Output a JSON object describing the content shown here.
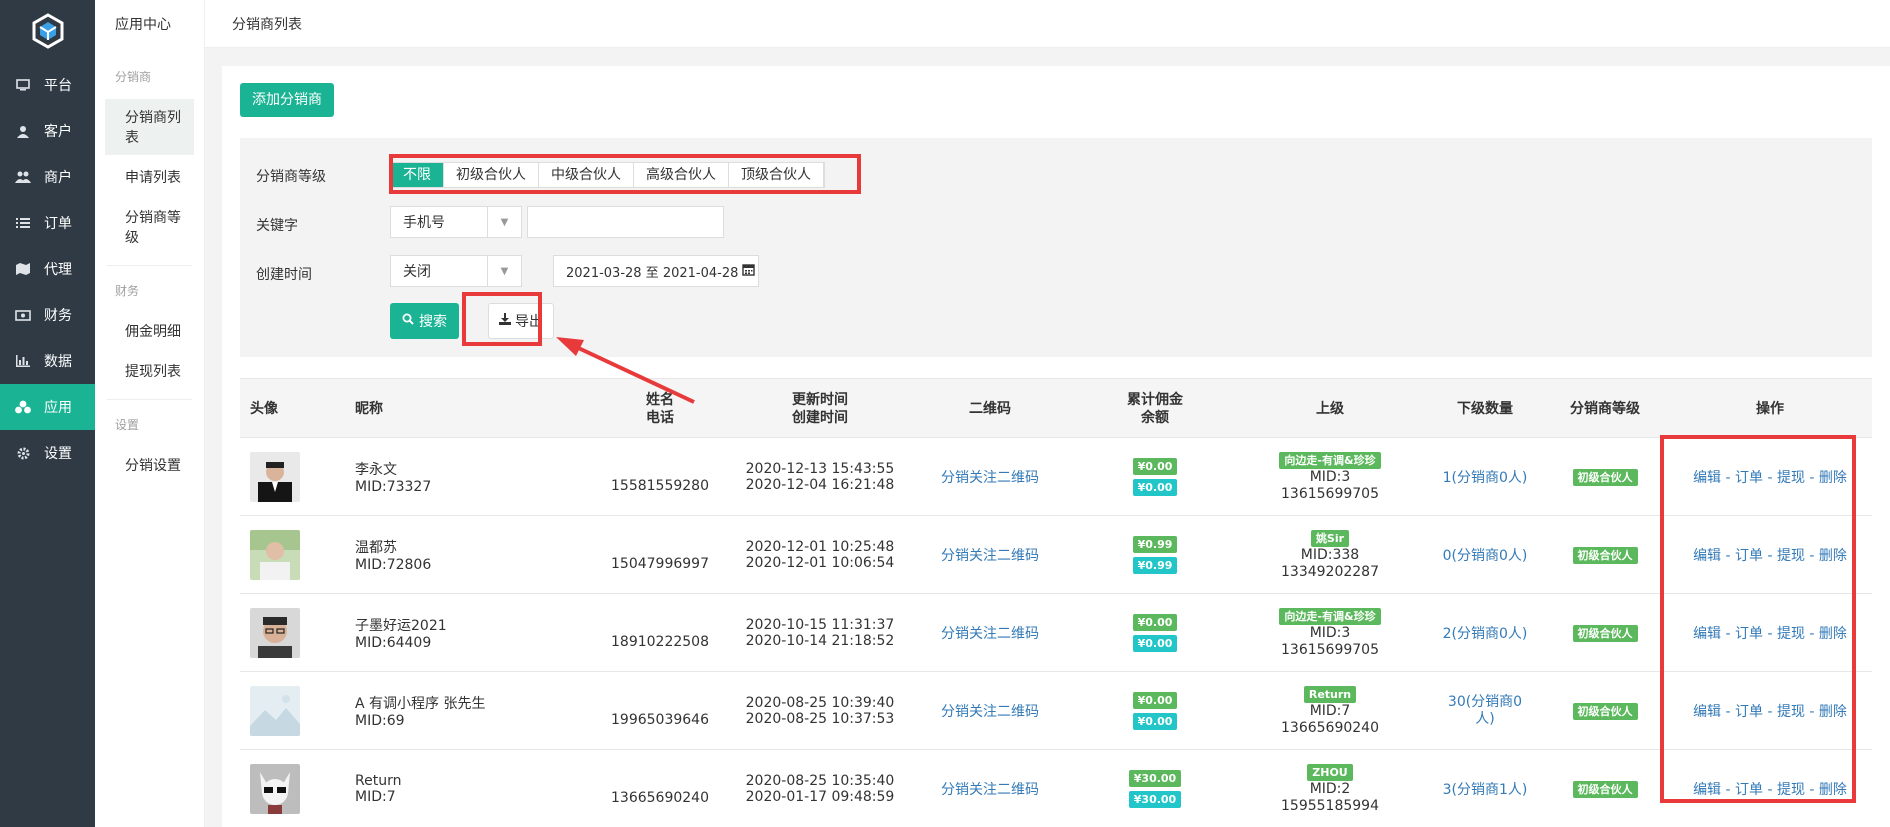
{
  "topbar": {
    "app_center": "应用中心",
    "current": "分销商列表"
  },
  "sidebar": {
    "items": [
      {
        "label": "平台",
        "icon": "monitor-icon"
      },
      {
        "label": "客户",
        "icon": "user-icon"
      },
      {
        "label": "商户",
        "icon": "users-icon"
      },
      {
        "label": "订单",
        "icon": "list-icon"
      },
      {
        "label": "代理",
        "icon": "map-icon"
      },
      {
        "label": "财务",
        "icon": "money-icon"
      },
      {
        "label": "数据",
        "icon": "bar-chart-icon"
      },
      {
        "label": "应用",
        "icon": "cubes-icon"
      },
      {
        "label": "设置",
        "icon": "gear-icon"
      }
    ]
  },
  "submenu": {
    "group1": "分销商",
    "items1": [
      "分销商列表",
      "申请列表",
      "分销商等级"
    ],
    "group2": "财务",
    "items2": [
      "佣金明细",
      "提现列表"
    ],
    "group3": "设置",
    "items3": [
      "分销设置"
    ]
  },
  "toolbar": {
    "add_label": "添加分销商"
  },
  "filter": {
    "level_label": "分销商等级",
    "levels": [
      "不限",
      "初级合伙人",
      "中级合伙人",
      "高级合伙人",
      "顶级合伙人"
    ],
    "keyword_label": "关键字",
    "keyword_type": "手机号",
    "keyword_value": "",
    "time_label": "创建时间",
    "time_mode": "关闭",
    "date_range": "2021-03-28 至 2021-04-28",
    "search_label": "搜索",
    "export_label": "导出"
  },
  "table": {
    "headers": {
      "avatar": "头像",
      "nickname": "昵称",
      "name": "姓名",
      "phone": "电话",
      "updated": "更新时间",
      "created": "创建时间",
      "qrcode": "二维码",
      "commission": "累计佣金",
      "balance": "余额",
      "parent": "上级",
      "children": "下级数量",
      "level": "分销商等级",
      "actions": "操作"
    },
    "rows": [
      {
        "nickname": "李永文",
        "mid": "MID:73327",
        "phone": "15581559280",
        "updated": "2020-12-13 15:43:55",
        "created": "2020-12-04 16:21:48",
        "qrcode": "分销关注二维码",
        "commission": "¥0.00",
        "balance": "¥0.00",
        "parent_tag": "向边走-有调&珍珍",
        "parent_mid": "MID:3",
        "parent_phone": "13615699705",
        "children": "1(分销商0人)",
        "level": "初级合伙人"
      },
      {
        "nickname": "温都苏",
        "mid": "MID:72806",
        "phone": "15047996997",
        "updated": "2020-12-01 10:25:48",
        "created": "2020-12-01 10:06:54",
        "qrcode": "分销关注二维码",
        "commission": "¥0.99",
        "balance": "¥0.99",
        "parent_tag": "姚Sir",
        "parent_mid": "MID:338",
        "parent_phone": "13349202287",
        "children": "0(分销商0人)",
        "level": "初级合伙人"
      },
      {
        "nickname": "子墨好运2021",
        "mid": "MID:64409",
        "phone": "18910222508",
        "updated": "2020-10-15 11:31:37",
        "created": "2020-10-14 21:18:52",
        "qrcode": "分销关注二维码",
        "commission": "¥0.00",
        "balance": "¥0.00",
        "parent_tag": "向边走-有调&珍珍",
        "parent_mid": "MID:3",
        "parent_phone": "13615699705",
        "children": "2(分销商0人)",
        "level": "初级合伙人"
      },
      {
        "nickname": "A 有调小程序 张先生",
        "mid": "MID:69",
        "phone": "19965039646",
        "updated": "2020-08-25 10:39:40",
        "created": "2020-08-25 10:37:53",
        "qrcode": "分销关注二维码",
        "commission": "¥0.00",
        "balance": "¥0.00",
        "parent_tag": "Return",
        "parent_mid": "MID:7",
        "parent_phone": "13665690240",
        "children_line1": "30(分销商0",
        "children_line2": "人)",
        "level": "初级合伙人"
      },
      {
        "nickname": "Return",
        "mid": "MID:7",
        "phone": "13665690240",
        "updated": "2020-08-25 10:35:40",
        "created": "2020-01-17 09:48:59",
        "qrcode": "分销关注二维码",
        "commission": "¥30.00",
        "balance": "¥30.00",
        "parent_tag": "ZHOU",
        "parent_mid": "MID:2",
        "parent_phone": "15955185994",
        "children": "3(分销商1人)",
        "level": "初级合伙人"
      }
    ],
    "actions": {
      "edit": "编辑",
      "orders": "订单",
      "withdraw": "提现",
      "delete": "删除",
      "sep": " - "
    }
  },
  "colors": {
    "sidebar_bg": "#2f3a45",
    "accent": "#1ab394",
    "link": "#337ab7",
    "highlight": "#e83a3a",
    "tag_green": "#5cb85c",
    "tag_cyan": "#23c6c8"
  }
}
